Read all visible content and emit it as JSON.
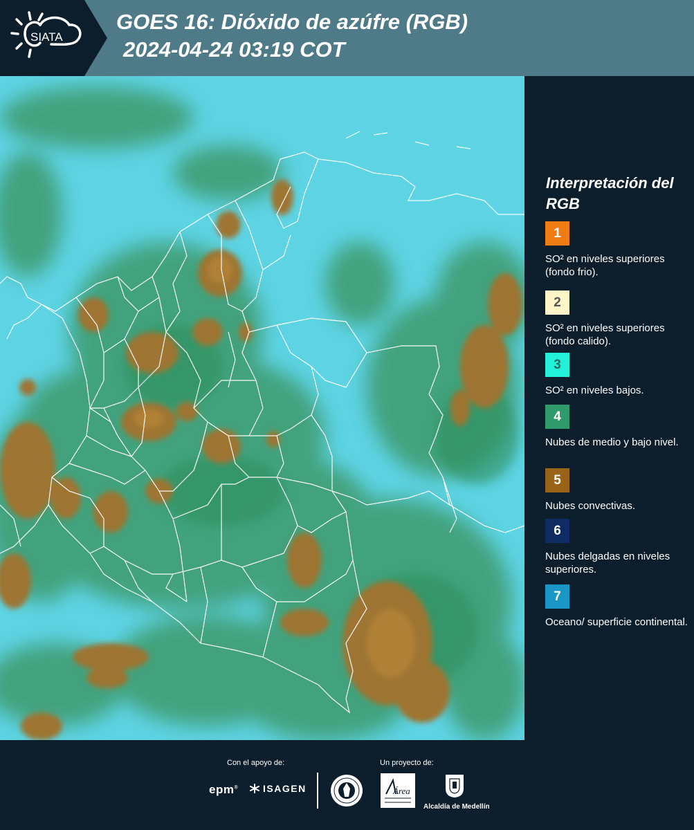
{
  "header": {
    "logo_text": "SIATA",
    "title_line1": "GOES 16: Dióxido de azúfre (RGB)",
    "title_line2": "2024-04-24 03:19 COT"
  },
  "legend": {
    "title": "Interpretación del RGB",
    "items": [
      {
        "number": "1",
        "color": "#f07d14",
        "text_color": "#ffffff",
        "label": "SO² en niveles superiores (fondo frio)."
      },
      {
        "number": "2",
        "color": "#fef6c8",
        "text_color": "#555555",
        "label": "SO² en niveles superiores (fondo calido)."
      },
      {
        "number": "3",
        "color": "#22f0d8",
        "text_color": "#2a6a66",
        "label": "SO² en niveles bajos."
      },
      {
        "number": "4",
        "color": "#2f9a6a",
        "text_color": "#ffffff",
        "label": "Nubes de medio y bajo nivel."
      },
      {
        "number": "5",
        "color": "#9a6418",
        "text_color": "#ffffff",
        "label": "Nubes convectivas."
      },
      {
        "number": "6",
        "color": "#0e2c62",
        "text_color": "#ffffff",
        "label": "Nubes delgadas en niveles superiores."
      },
      {
        "number": "7",
        "color": "#1a96c6",
        "text_color": "#ffffff",
        "label": "Oceano/ superficie continental."
      }
    ]
  },
  "footer": {
    "support_label": "Con el apoyo de:",
    "project_label": "Un proyecto de:",
    "epm": "epm",
    "isagen": "ISAGEN",
    "area_logo_text": "Área",
    "alcaldia": "Alcaldía de Medellín"
  },
  "colors": {
    "ocean_cyan": "#4fcfe0",
    "cloud_green": "#3d9a6c",
    "convective_brown": "#9a7230",
    "background": "#0c1e2b",
    "header": "#4f7a87"
  }
}
